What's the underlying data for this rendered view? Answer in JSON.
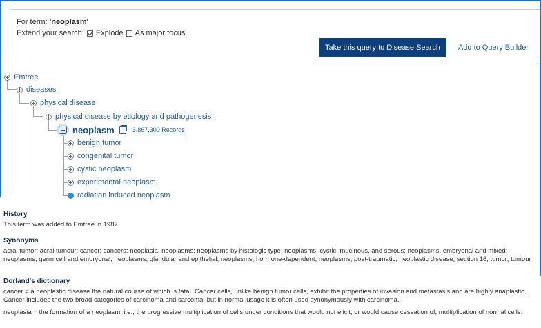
{
  "query": {
    "for_term_prefix": "For term: ",
    "term": "'neoplasm'",
    "extend_label": "Extend your search:",
    "explode_label": "Explode",
    "explode_checked": true,
    "major_focus_label": "As major focus",
    "major_focus_checked": false,
    "primary_button": "Take this query to Disease Search",
    "secondary_button": "Add to Query Builder"
  },
  "tree": {
    "root": "Emtree",
    "level1": "diseases",
    "level2": "physical disease",
    "level3": "physical disease by etiology and pathogenesis",
    "current": "neoplasm",
    "records": "3,867,300 Records",
    "children": [
      "benign tumor",
      "congenital tumor",
      "cystic neoplasm",
      "experimental neoplasm",
      "radiation induced neoplasm"
    ]
  },
  "history": {
    "heading": "History",
    "text": "This term was added to Emtree in 1987"
  },
  "synonyms": {
    "heading": "Synonyms",
    "text": "acral tumor; acral tumour; cancer; cancers; neoplasia; neoplasms; neoplasms by histologic type; neoplasms, cystic, mucinous, and serous; neoplasms, embryonal and mixed; neoplasms, germ cell and embryonal; neoplasms, glandular and epithelial; neoplasms, hormone-dependent; neoplasms, post-traumatic; neoplastic disease; section 16; tumor; tumour"
  },
  "dorland": {
    "heading": "Dorland's dictionary",
    "p1": "cancer = a neoplastic disease the natural course of which is fatal. Cancer cells, unlike benign tumor cells, exhibit the properties of invasion and metastasis and are highly anaplastic. Cancer includes the two broad categories of carcinoma and sarcoma, but in normal usage it is often used synonymously with carcinoma.",
    "p2": "neoplasia = the formation of a neoplasm, i.e., the progressive multiplication of cells under conditions that would not elicit, or would cause cessation of, multiplication of normal cells."
  },
  "colors": {
    "accent": "#1a73c8",
    "primary_button_bg": "#0d3f7d",
    "link": "#2a62a6"
  }
}
